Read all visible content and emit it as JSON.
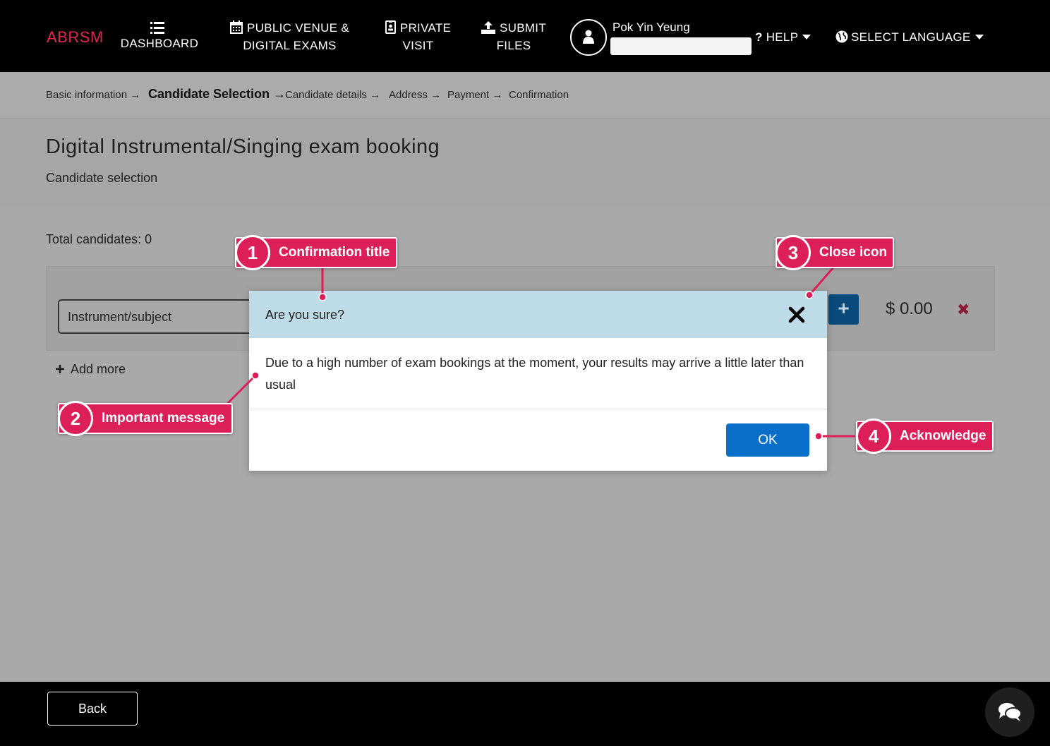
{
  "nav": {
    "logo": "ABRSM",
    "items": [
      {
        "line1": "DASHBOARD",
        "line2": "",
        "icon": "list-icon"
      },
      {
        "line1": "PUBLIC VENUE &",
        "line2": "DIGITAL EXAMS",
        "icon": "calendar-icon"
      },
      {
        "line1": "PRIVATE",
        "line2": "VISIT",
        "icon": "id-card-icon"
      },
      {
        "line1": "SUBMIT",
        "line2": "FILES",
        "icon": "upload-icon"
      }
    ],
    "user_name": "Pok Yin Yeung",
    "help": "HELP",
    "language": "SELECT LANGUAGE"
  },
  "breadcrumb": {
    "steps": [
      "Basic information",
      "Candidate Selection",
      "Candidate details",
      "Address",
      "Payment",
      "Confirmation"
    ],
    "active_index": 1
  },
  "page": {
    "title": "Digital Instrumental/Singing exam booking",
    "subtitle": "Candidate selection",
    "total_candidates": "Total candidates: 0",
    "instrument_placeholder": "Instrument/subject",
    "price": "$ 0.00",
    "add_more": "Add more"
  },
  "modal": {
    "title": "Are you sure?",
    "message": "Due to a high number of exam bookings at the moment, your results may arrive a little later than usual",
    "ok_label": "OK"
  },
  "annotations": [
    {
      "num": "1",
      "label": "Confirmation title"
    },
    {
      "num": "2",
      "label": "Important message"
    },
    {
      "num": "3",
      "label": "Close icon"
    },
    {
      "num": "4",
      "label": "Acknowledge"
    }
  ],
  "footer": {
    "back_label": "Back"
  },
  "colors": {
    "brand": "#e5264f",
    "annotation": "#dc1f58",
    "modal_header": "#bddce8",
    "primary_button": "#0a6fc9"
  }
}
